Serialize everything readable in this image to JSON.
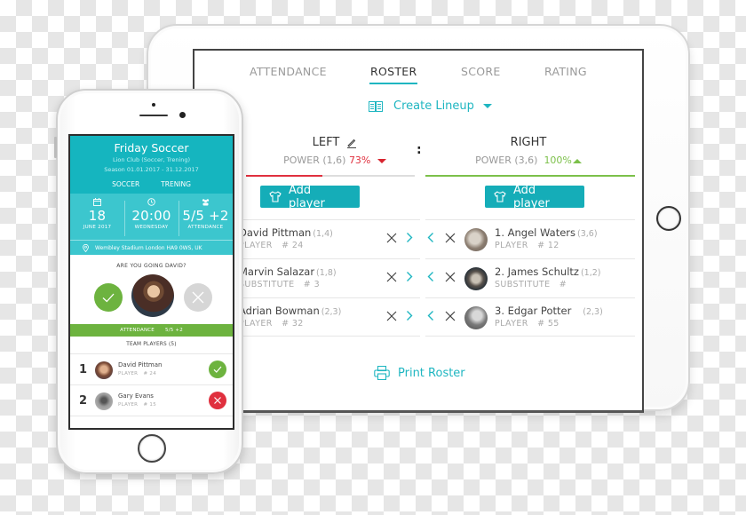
{
  "colors": {
    "accent": "#1fb6c1",
    "header_teal": "#15b5bf",
    "info_teal": "#3cc6ce",
    "green": "#6db33f",
    "red": "#e0303e",
    "grey_button": "#d6d6d6"
  },
  "tablet": {
    "tabs": [
      {
        "label": "ATTENDANCE",
        "active": false
      },
      {
        "label": "ROSTER",
        "active": true
      },
      {
        "label": "SCORE",
        "active": false
      },
      {
        "label": "RATING",
        "active": false
      }
    ],
    "lineup_label": "Create Lineup",
    "separator": ":",
    "left_team": {
      "name": "LEFT",
      "power_label": "POWER (1,6)",
      "power_pct_label": "73%",
      "power_fraction": 0.73,
      "trend": "down",
      "add_label": "Add player",
      "players": [
        {
          "name": "David Pittman",
          "rating": "(1,4)",
          "role": "PLAYER",
          "number": "# 24"
        },
        {
          "name": "Marvin Salazar",
          "rating": "(1,8)",
          "role": "SUBSTITUTE",
          "number": "# 3"
        },
        {
          "name": "Adrian Bowman",
          "rating": "(2,3)",
          "role": "PLAYER",
          "number": "# 32"
        }
      ]
    },
    "right_team": {
      "name": "RIGHT",
      "power_label": "POWER (3,6)",
      "power_pct_label": "100%",
      "power_fraction": 1.0,
      "trend": "up",
      "add_label": "Add player",
      "players": [
        {
          "name": "1. Angel Waters",
          "rating": "(3,6)",
          "role": "PLAYER",
          "number": "# 12"
        },
        {
          "name": "2. James Schultz",
          "rating": "(1,2)",
          "role": "SUBSTITUTE",
          "number": "#"
        },
        {
          "name": "3. Edgar Potter",
          "rating": "(2,3)",
          "role": "PLAYER",
          "number": "# 55"
        }
      ]
    },
    "print_label": "Print Roster"
  },
  "phone": {
    "title": "Friday Soccer",
    "club": "Lion Club (Soccer, Trening)",
    "season": "Season 01.01.2017 - 31.12.2017",
    "tabs": [
      "SOCCER",
      "TRENING"
    ],
    "date": {
      "big": "18",
      "small": "JUNE 2017"
    },
    "time": {
      "big": "20:00",
      "small": "WEDNESDAY"
    },
    "attendance": {
      "big": "5/5 +2",
      "small": "ATTENDANCE"
    },
    "location": "Wembley Stadium London HA9 0WS, UK",
    "question": "ARE YOU GOING DAVID?",
    "attendance_bar": {
      "label": "ATTENDANCE",
      "value": "5/5 +2"
    },
    "team_players_label": "TEAM PLAYERS (5)",
    "players": [
      {
        "num": "1",
        "name": "David Pittman",
        "role": "PLAYER",
        "number": "# 24",
        "status": "going"
      },
      {
        "num": "2",
        "name": "Gary Evans",
        "role": "PLAYER",
        "number": "# 15",
        "status": "not-going"
      }
    ]
  }
}
